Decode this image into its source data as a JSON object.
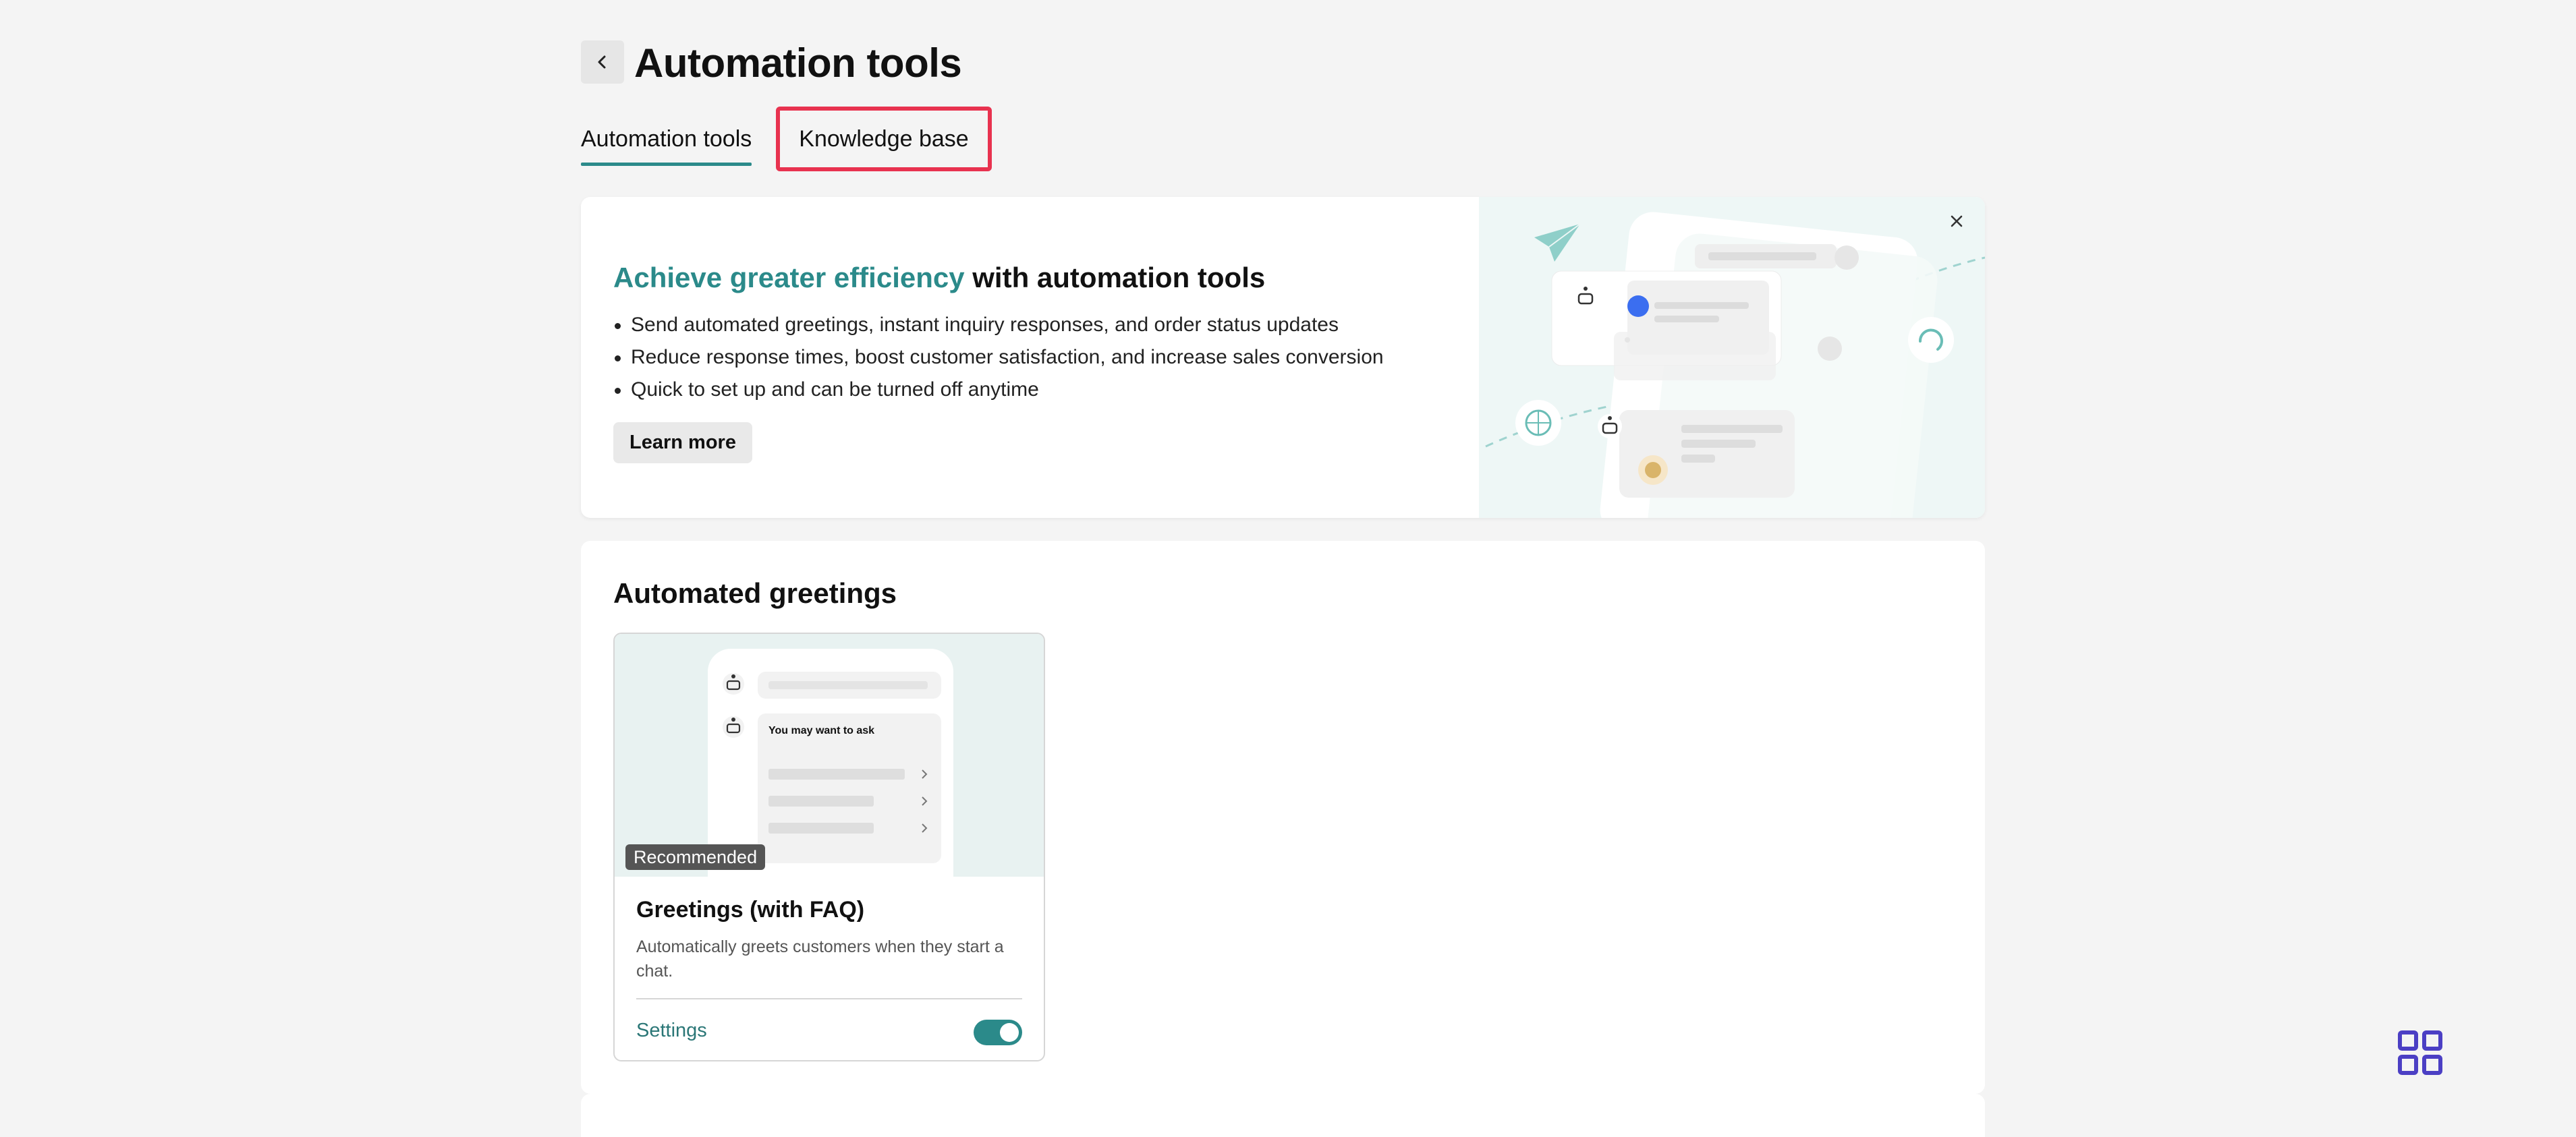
{
  "header": {
    "title": "Automation tools",
    "back_icon": "chevron-left-icon"
  },
  "tabs": [
    {
      "label": "Automation tools",
      "active": true
    },
    {
      "label": "Knowledge base",
      "active": false,
      "highlighted": true
    }
  ],
  "banner": {
    "heading_accent": "Achieve greater efficiency",
    "heading_rest": " with automation tools",
    "bullets": [
      "Send automated greetings, instant inquiry responses, and order status updates",
      "Reduce response times, boost customer satisfaction, and increase sales conversion",
      "Quick to set up and can be turned off anytime"
    ],
    "learn_more": "Learn more",
    "close_icon": "close-icon"
  },
  "greetings_section": {
    "title": "Automated greetings",
    "card": {
      "preview_text": "You may want to ask",
      "badge": "Recommended",
      "title": "Greetings (with FAQ)",
      "description": "Automatically greets customers when they start a chat.",
      "settings_label": "Settings",
      "enabled": true
    }
  },
  "colors": {
    "accent": "#2b8a8a",
    "highlight": "#e8324f",
    "apps_icon": "#4b3fc4"
  }
}
